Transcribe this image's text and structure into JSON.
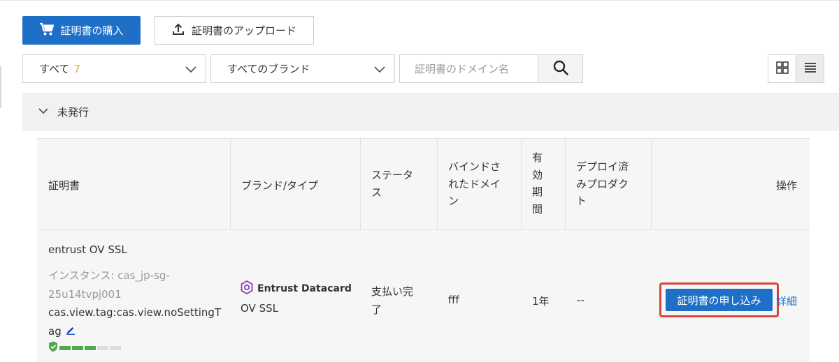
{
  "toolbar": {
    "buy_label": "証明書の購入",
    "upload_label": "証明書のアップロード"
  },
  "filters": {
    "status_select": "すべて",
    "status_count": "7",
    "brand_select": "すべてのブランド",
    "search_placeholder": "証明書のドメイン名"
  },
  "group": {
    "label": "未発行"
  },
  "table": {
    "headers": {
      "cert": "証明書",
      "brand": "ブランド/タイプ",
      "status_1": "ステータ",
      "status_2": "ス",
      "domain_1": "バインドさ",
      "domain_2": "れたドメイ",
      "domain_3": "ン",
      "valid_1": "有",
      "valid_2": "効",
      "valid_3": "期",
      "valid_4": "間",
      "deploy_1": "デプロイ済",
      "deploy_2": "みプロダク",
      "deploy_3": "ト",
      "ops": "操作"
    },
    "row": {
      "name": "entrust OV SSL",
      "instance_1": "インスタンス: cas_jp-sg-",
      "instance_2": "25u14tvpj001",
      "tag_1": "cas.view.tag:cas.view.noSettingT",
      "tag_2": "ag",
      "brand_name": "Entrust Datacard",
      "cert_type": "OV SSL",
      "status_1": "支払い完",
      "status_2": "了",
      "domain": "fff",
      "validity": "1年",
      "deployed": "--",
      "apply_label": "証明書の申し込み",
      "detail_label": "詳細"
    }
  },
  "colors": {
    "primary": "#1e6fc8",
    "highlight_border": "#d9453a",
    "count": "#e6a23c",
    "strength_on": "#52a84a",
    "strength_off": "#dddddd"
  },
  "icons": {
    "buy": "cart-icon",
    "upload": "upload-icon",
    "search": "search-icon",
    "grid": "grid-view-icon",
    "list": "list-view-icon",
    "collapse": "chevron-down-icon",
    "edit": "edit-icon",
    "shield": "shield-check-icon"
  }
}
